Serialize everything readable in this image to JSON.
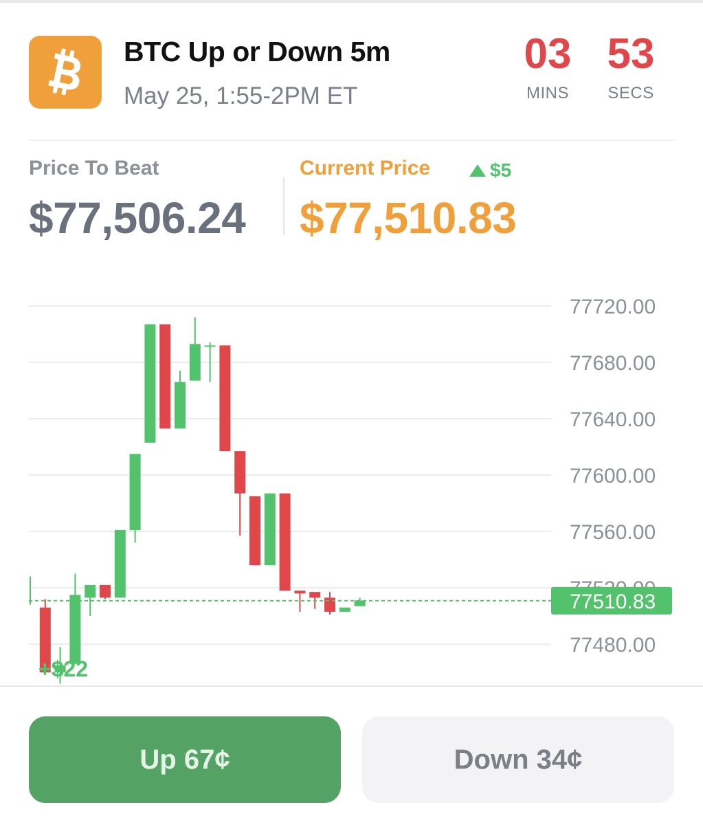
{
  "market": {
    "title": "BTC Up or Down 5m",
    "subtitle": "May 25, 1:55-2PM ET",
    "logo_icon": "bitcoin-logo-icon",
    "logo_color": "#f0a03a"
  },
  "countdown": {
    "minutes": "03",
    "minutes_label": "MINS",
    "seconds": "53",
    "seconds_label": "SECS",
    "color": "#e0474a"
  },
  "prices": {
    "price_to_beat_label": "Price To Beat",
    "price_to_beat": "$77,506.24",
    "current_price_label": "Current Price",
    "current_price": "$77,510.83",
    "change": "$5",
    "change_icon": "triangle-up-icon",
    "accent_color": "#f0a03a",
    "up_color": "#53c26c"
  },
  "chart_data": {
    "type": "candlestick",
    "y_ticks": [
      "77720.00",
      "77680.00",
      "77640.00",
      "77600.00",
      "77560.00",
      "77520.00",
      "77480.00"
    ],
    "ylim": [
      77450,
      77722
    ],
    "grid": true,
    "current_price_label": "77510.83",
    "current_price": 77510.83,
    "floating_label": "+$22",
    "candles": [
      {
        "open": 77511,
        "high": 77528,
        "low": 77508,
        "close": 77511
      },
      {
        "open": 77506,
        "high": 77512,
        "low": 77460,
        "close": 77460
      },
      {
        "open": 77460,
        "high": 77478,
        "low": 77452,
        "close": 77465
      },
      {
        "open": 77466,
        "high": 77530,
        "low": 77466,
        "close": 77515
      },
      {
        "open": 77513,
        "high": 77515,
        "low": 77500,
        "close": 77522
      },
      {
        "open": 77522,
        "high": 77522,
        "low": 77512,
        "close": 77513
      },
      {
        "open": 77513,
        "high": 77561,
        "low": 77513,
        "close": 77561
      },
      {
        "open": 77561,
        "high": 77615,
        "low": 77552,
        "close": 77615
      },
      {
        "open": 77623,
        "high": 77707,
        "low": 77623,
        "close": 77707
      },
      {
        "open": 77707,
        "high": 77707,
        "low": 77633,
        "close": 77633
      },
      {
        "open": 77633,
        "high": 77674,
        "low": 77633,
        "close": 77666
      },
      {
        "open": 77667,
        "high": 77712,
        "low": 77667,
        "close": 77693
      },
      {
        "open": 77692,
        "high": 77694,
        "low": 77666,
        "close": 77692
      },
      {
        "open": 77692,
        "high": 77692,
        "low": 77617,
        "close": 77617
      },
      {
        "open": 77617,
        "high": 77617,
        "low": 77557,
        "close": 77587
      },
      {
        "open": 77585,
        "high": 77585,
        "low": 77536,
        "close": 77536
      },
      {
        "open": 77536,
        "high": 77587,
        "low": 77536,
        "close": 77587
      },
      {
        "open": 77587,
        "high": 77587,
        "low": 77518,
        "close": 77518
      },
      {
        "open": 77518,
        "high": 77518,
        "low": 77503,
        "close": 77516
      },
      {
        "open": 77517,
        "high": 77517,
        "low": 77505,
        "close": 77513
      },
      {
        "open": 77513,
        "high": 77517,
        "low": 77501,
        "close": 77503
      },
      {
        "open": 77503,
        "high": 77506,
        "low": 77503,
        "close": 77506
      },
      {
        "open": 77507,
        "high": 77513,
        "low": 77507,
        "close": 77511
      }
    ],
    "up_color": "#53c26c",
    "down_color": "#e0474a",
    "grid_color": "#ececef",
    "tick_color": "#8b9099"
  },
  "actions": {
    "up_label": "Up 67¢",
    "down_label": "Down 34¢",
    "up_color": "#55a364",
    "down_color": "#f3f3f5"
  }
}
